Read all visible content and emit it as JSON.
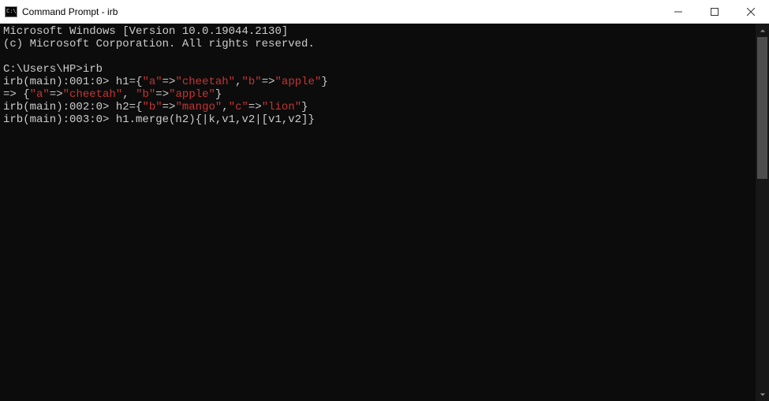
{
  "window": {
    "title": "Command Prompt - irb"
  },
  "terminal": {
    "line1": "Microsoft Windows [Version 10.0.19044.2130]",
    "line2": "(c) Microsoft Corporation. All rights reserved.",
    "blank1": "",
    "prompt1": "C:\\Users\\HP>irb",
    "l4_a": "irb(main):001:0> h1={",
    "l4_b": "\"a\"",
    "l4_c": "=>",
    "l4_d": "\"cheetah\"",
    "l4_e": ",",
    "l4_f": "\"b\"",
    "l4_g": "=>",
    "l4_h": "\"apple\"",
    "l4_i": "}",
    "l5_a": "=> {",
    "l5_b": "\"a\"",
    "l5_c": "=>",
    "l5_d": "\"cheetah\"",
    "l5_e": ", ",
    "l5_f": "\"b\"",
    "l5_g": "=>",
    "l5_h": "\"apple\"",
    "l5_i": "}",
    "l6_a": "irb(main):002:0> h2={",
    "l6_b": "\"b\"",
    "l6_c": "=>",
    "l6_d": "\"mango\"",
    "l6_e": ",",
    "l6_f": "\"c\"",
    "l6_g": "=>",
    "l6_h": "\"lion\"",
    "l6_i": "}",
    "l7": "irb(main):003:0> h1.merge(h2){|k,v1,v2|[v1,v2]}"
  }
}
